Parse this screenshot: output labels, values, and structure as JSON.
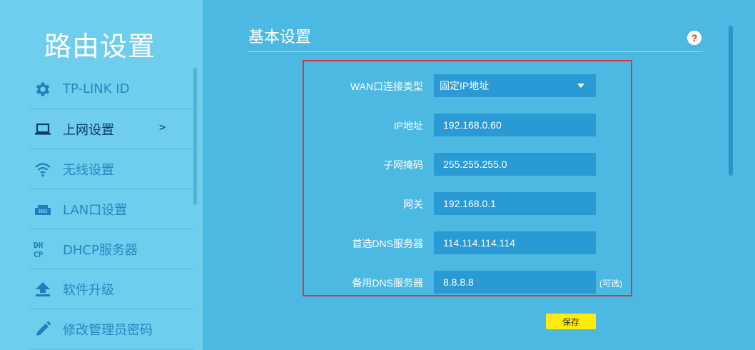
{
  "sidebar": {
    "title": "路由设置",
    "items": [
      {
        "label": "TP-LINK ID",
        "icon": "gear-icon"
      },
      {
        "label": "上网设置",
        "icon": "laptop-icon",
        "active": true,
        "arrow": ">"
      },
      {
        "label": "无线设置",
        "icon": "wifi-icon"
      },
      {
        "label": "LAN口设置",
        "icon": "lan-port-icon"
      },
      {
        "label": "DHCP服务器",
        "icon": "dhcp-icon",
        "icon_text_top": "DH",
        "icon_text_bottom": "CP"
      },
      {
        "label": "软件升级",
        "icon": "upload-icon"
      },
      {
        "label": "修改管理员密码",
        "icon": "pencil-icon"
      }
    ]
  },
  "main": {
    "section_title": "基本设置",
    "help_label": "?",
    "form": {
      "wan_type": {
        "label": "WAN口连接类型",
        "value": "固定IP地址"
      },
      "ip": {
        "label": "IP地址",
        "value": "192.168.0.60"
      },
      "subnet": {
        "label": "子网掩码",
        "value": "255.255.255.0"
      },
      "gateway": {
        "label": "网关",
        "value": "192.168.0.1"
      },
      "dns_primary": {
        "label": "首选DNS服务器",
        "value": "114.114.114.114"
      },
      "dns_secondary": {
        "label": "备用DNS服务器",
        "value": "8.8.8.8",
        "note": "(可选)"
      }
    },
    "save_label": "保存"
  },
  "colors": {
    "sidebar_bg": "#6fcdee",
    "main_bg": "#4bb9e1",
    "field_bg": "#2a9ad4",
    "nav_text": "#2a86bf",
    "nav_active_text": "#0d3d63",
    "highlight_border": "#e0333b",
    "save_button_bg": "#ffec0b"
  }
}
